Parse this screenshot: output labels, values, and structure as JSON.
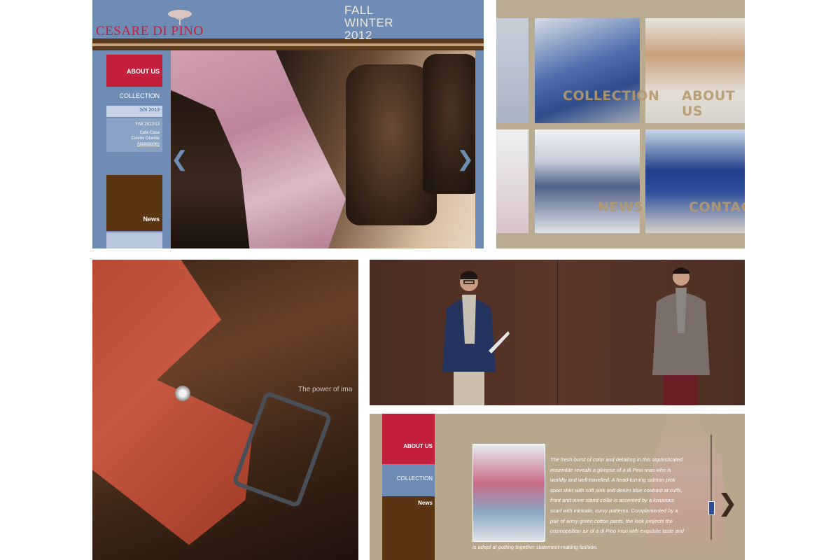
{
  "home": {
    "logo": "CESARE DI PINO",
    "nav": {
      "about": "ABOUT US",
      "collection": "COLLECTION",
      "ss": "S/S 2013",
      "fw": "F/W 2012/13",
      "fw_sub": [
        "Cafe Casa",
        "Cosmo Grande",
        "Accessories"
      ],
      "news": "News"
    },
    "season_line1": "FALL",
    "season_line2": "WINTER",
    "season_line3": "2012",
    "colors": {
      "blue": "#6f8cb4",
      "red": "#c41f3d",
      "brown": "#5b3512"
    },
    "icons": {
      "prev": "chevron-left-icon",
      "next": "chevron-right-icon"
    }
  },
  "grid": {
    "labels": {
      "collection": "COLLECTION",
      "about": "ABOUT US",
      "news": "NEWS",
      "contact": "CONTACT"
    }
  },
  "belt": {
    "tagline": "The power of ima"
  },
  "about_page": {
    "nav": {
      "about": "ABOUT US",
      "collection": "COLLECTION",
      "news": "News"
    },
    "lines": [
      "The fresh burst of color and detailing in this sophisticated",
      "ensemble reveals a glimpse of a di Pino man who is",
      "worldly and well-travelled. A head-turning salmon pink",
      "sport shirt with soft pink and denim blue contrast at cuffs,",
      "front and inner stand collar is accented by a luxurious",
      "scarf with intricate, curvy patterns. Complemented by a",
      "pair of army green cotton pants, the look projects the",
      "cosmopolitan air of a di Pino man with exquisite taste and"
    ],
    "last_line": "is adept at putting together statement-making fashion."
  }
}
